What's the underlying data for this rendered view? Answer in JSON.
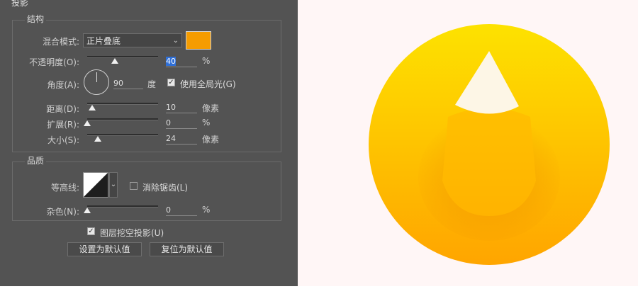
{
  "panel": {
    "title": "投影",
    "structure": {
      "legend": "结构",
      "blend_mode_label": "混合模式:",
      "blend_mode_value": "正片叠底",
      "swatch_color": "#f59c00",
      "opacity_label": "不透明度(O):",
      "opacity_value": "40",
      "opacity_unit": "%",
      "opacity_level": 0.4,
      "angle_label": "角度(A):",
      "angle_value": "90",
      "angle_unit": "度",
      "global_light_label": "使用全局光(G)",
      "global_light_checked": true,
      "distance_label": "距离(D):",
      "distance_value": "10",
      "distance_unit": "像素",
      "spread_label": "扩展(R):",
      "spread_value": "0",
      "spread_unit": "%",
      "size_label": "大小(S):",
      "size_value": "24",
      "size_unit": "像素"
    },
    "quality": {
      "legend": "品质",
      "contour_label": "等高线:",
      "anti_alias_label": "消除锯齿(L)",
      "anti_alias_checked": false,
      "noise_label": "杂色(N):",
      "noise_value": "0",
      "noise_unit": "%"
    },
    "knockout_label": "图层挖空投影(U)",
    "knockout_checked": true,
    "make_default_label": "设置为默认值",
    "reset_default_label": "复位为默认值"
  },
  "colors": {
    "panel_bg": "#535353",
    "circle_top": "#fde000",
    "circle_bottom": "#ffa400",
    "drop_white": "#fdf6e6",
    "canvas_bg": "#fff6f6"
  }
}
